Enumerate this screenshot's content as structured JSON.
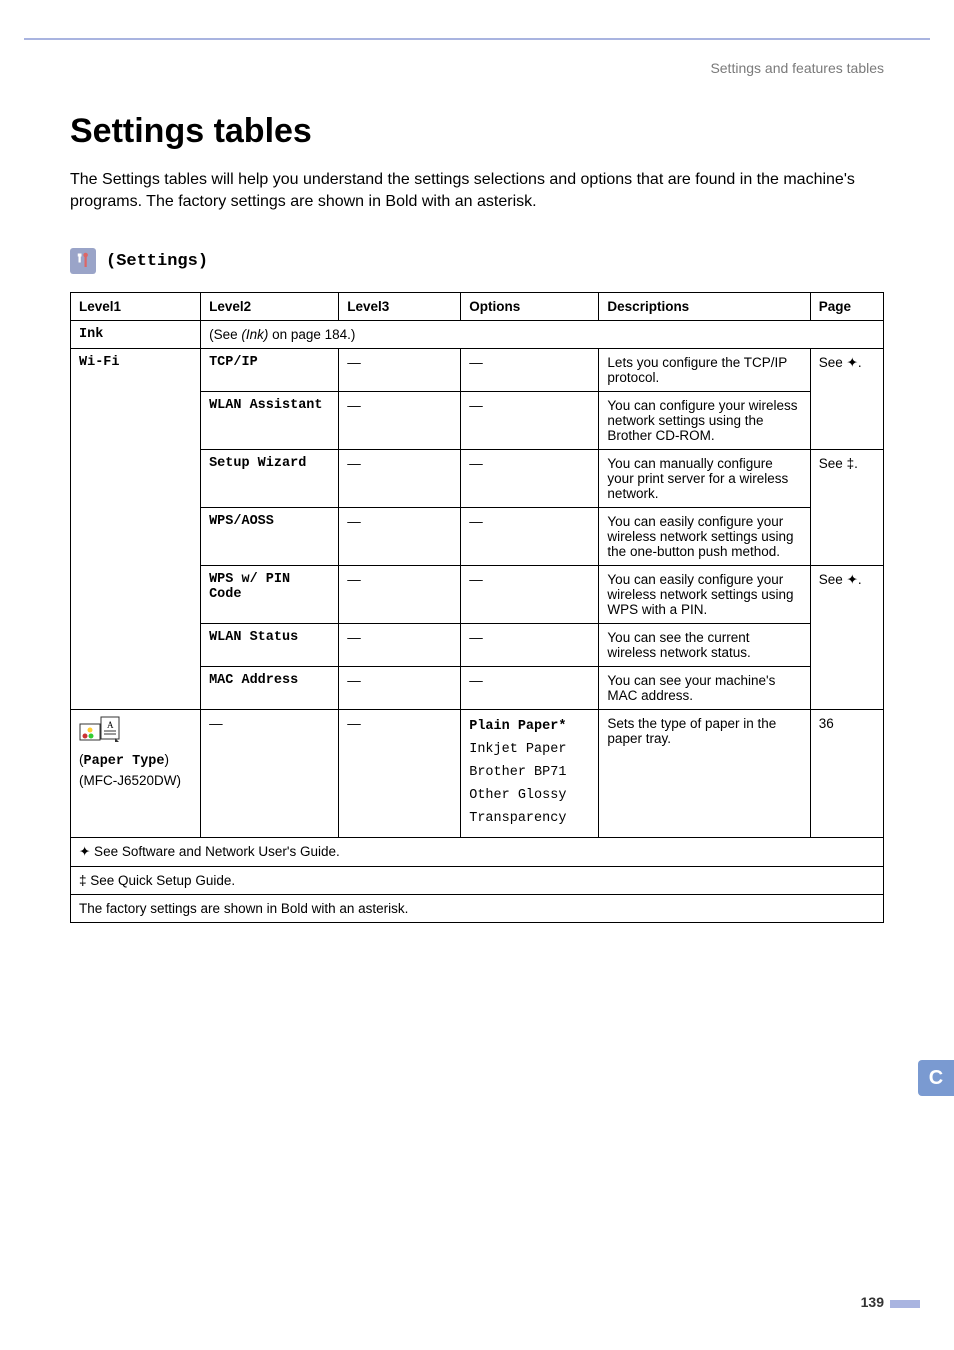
{
  "breadcrumb": "Settings and features tables",
  "title": "Settings tables",
  "intro": "The Settings tables will help you understand the settings selections and options that are found in the machine's programs. The factory settings are shown in Bold with an asterisk.",
  "section_label": "(Settings)",
  "headers": {
    "l1": "Level1",
    "l2": "Level2",
    "l3": "Level3",
    "opts": "Options",
    "desc": "Descriptions",
    "page": "Page"
  },
  "ink": {
    "l1": "Ink",
    "note_a": "(See ",
    "note_i": "(Ink)",
    "note_b": " on page 184.)"
  },
  "wifi": {
    "l1": "Wi-Fi",
    "rows": [
      {
        "l2": "TCP/IP",
        "l3": "—",
        "opt": "—",
        "desc": "Lets you configure the TCP/IP protocol.",
        "page": "See ✦."
      },
      {
        "l2": "WLAN Assistant",
        "l3": "—",
        "opt": "—",
        "desc": "You can configure your wireless network settings using the Brother CD-ROM.",
        "page": ""
      },
      {
        "l2": "Setup Wizard",
        "l3": "—",
        "opt": "—",
        "desc": "You can manually configure your print server for a wireless network.",
        "page": "See ‡."
      },
      {
        "l2": "WPS/AOSS",
        "l3": "—",
        "opt": "—",
        "desc": "You can easily configure your wireless network settings using the one-button push method.",
        "page": ""
      },
      {
        "l2": "WPS w/ PIN Code",
        "l3": "—",
        "opt": "—",
        "desc": "You can easily configure your wireless network settings using WPS with a PIN.",
        "page": "See ✦."
      },
      {
        "l2": "WLAN Status",
        "l3": "—",
        "opt": "—",
        "desc": "You can see the current wireless network status.",
        "page": ""
      },
      {
        "l2": "MAC Address",
        "l3": "—",
        "opt": "—",
        "desc": "You can see your machine's MAC address.",
        "page": ""
      }
    ]
  },
  "paper": {
    "l1a": "(",
    "l1b": "Paper Type",
    "l1c": ")",
    "model": "(MFC-J6520DW)",
    "l2": "—",
    "l3": "—",
    "opts": [
      "Plain Paper*",
      "Inkjet Paper",
      "Brother BP71",
      "Other Glossy",
      "Transparency"
    ],
    "desc": "Sets the type of paper in the paper tray.",
    "page": "36"
  },
  "footnotes": {
    "a": "✦ See Software and Network User's Guide.",
    "b": "‡ See Quick Setup Guide.",
    "c": "The factory settings are shown in Bold with an asterisk."
  },
  "tab": "C",
  "page_number": "139"
}
